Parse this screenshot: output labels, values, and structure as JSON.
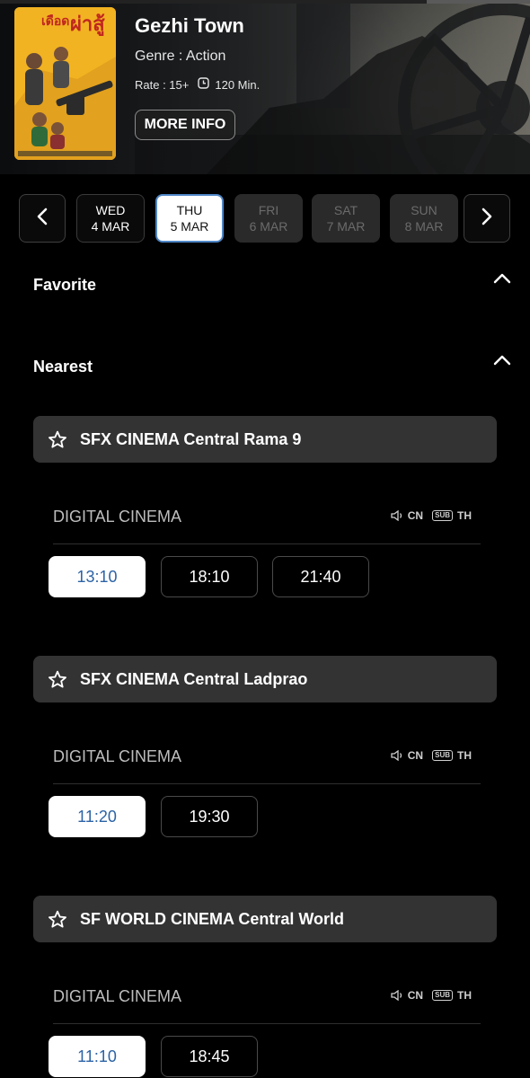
{
  "movie": {
    "title": "Gezhi Town",
    "genre": "Genre : Action",
    "rate": "Rate : 15+",
    "duration": "120 Min.",
    "more_info_label": "MORE INFO",
    "poster_text": "เดือด ผ่าสู้"
  },
  "dates": [
    {
      "day": "WED",
      "date": "4 MAR",
      "state": "enabled"
    },
    {
      "day": "THU",
      "date": "5 MAR",
      "state": "selected"
    },
    {
      "day": "FRI",
      "date": "6 MAR",
      "state": "disabled"
    },
    {
      "day": "SAT",
      "date": "7 MAR",
      "state": "disabled"
    },
    {
      "day": "SUN",
      "date": "8 MAR",
      "state": "disabled"
    }
  ],
  "sections": {
    "favorite": "Favorite",
    "nearest": "Nearest"
  },
  "cinemas": [
    {
      "name": "SFX CINEMA Central Rama 9",
      "format": "DIGITAL CINEMA",
      "audio": "CN",
      "sub_label": "SUB",
      "subtitle": "TH",
      "times": [
        "13:10",
        "18:10",
        "21:40"
      ]
    },
    {
      "name": "SFX CINEMA Central Ladprao",
      "format": "DIGITAL CINEMA",
      "audio": "CN",
      "sub_label": "SUB",
      "subtitle": "TH",
      "times": [
        "11:20",
        "19:30"
      ]
    },
    {
      "name": "SF WORLD CINEMA Central World",
      "format": "DIGITAL CINEMA",
      "audio": "CN",
      "sub_label": "SUB",
      "subtitle": "TH",
      "times": [
        "11:10",
        "18:45"
      ]
    }
  ],
  "colors": {
    "accent_blue": "#2c63a6",
    "selected_border": "#4f86c6",
    "card_bg": "#333333",
    "poster_yellow": "#f2b322"
  },
  "icons": {
    "prev": "chevron-left-icon",
    "next": "chevron-right-icon",
    "collapse": "chevron-up-icon",
    "favorite": "star-outline-icon",
    "clock": "clock-icon",
    "audio": "speaker-icon"
  }
}
